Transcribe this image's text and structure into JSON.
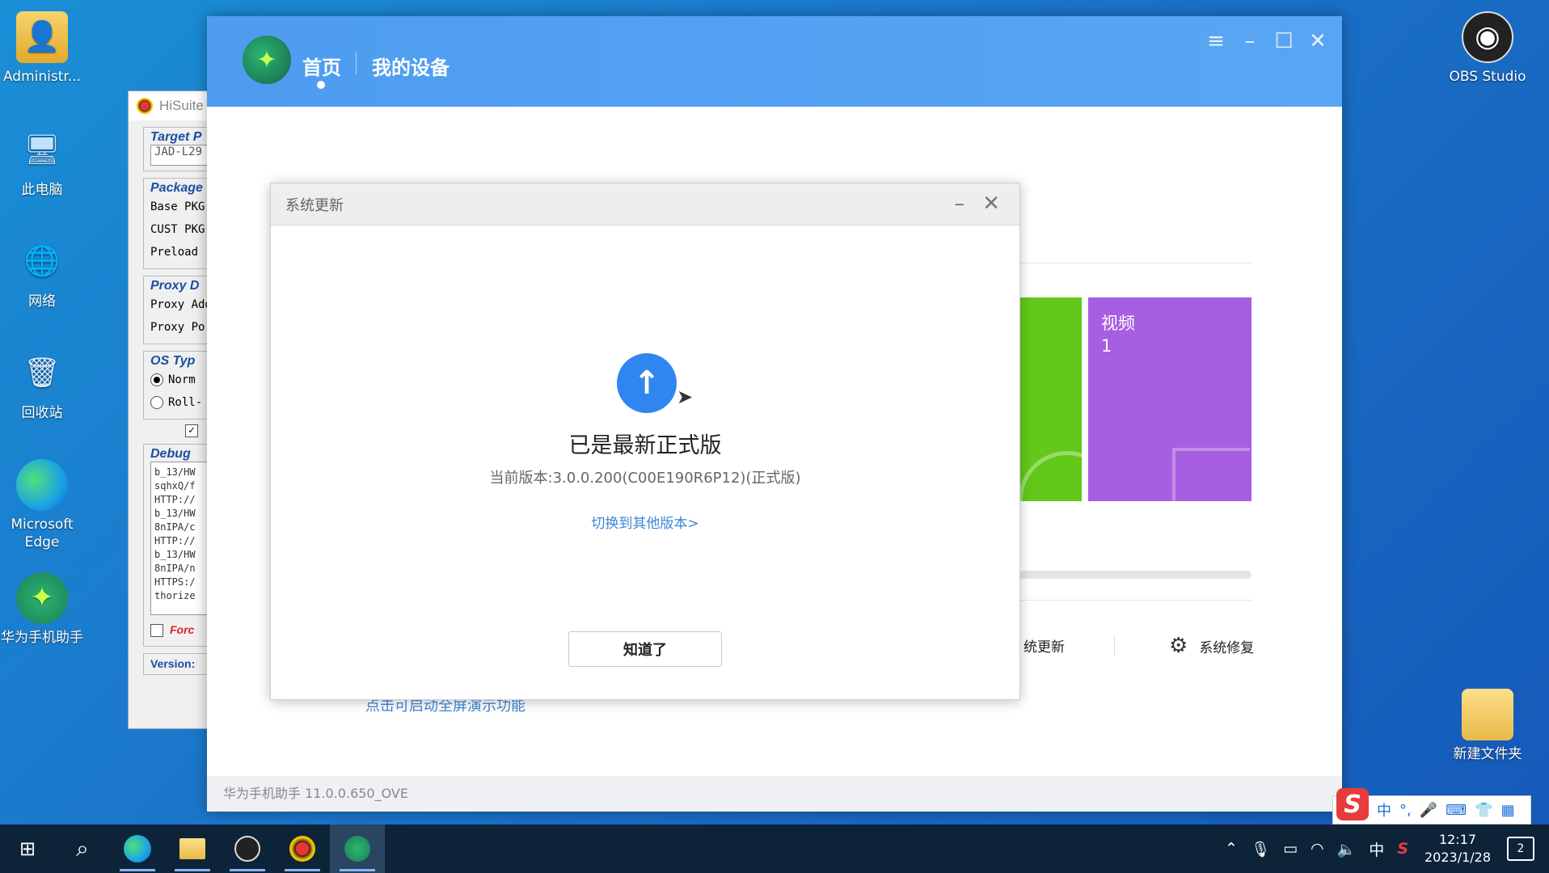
{
  "desktop": {
    "icons": [
      {
        "label": "Administr..."
      },
      {
        "label": "此电脑"
      },
      {
        "label": "网络"
      },
      {
        "label": "回收站"
      },
      {
        "label": "Microsoft Edge"
      },
      {
        "label": "华为手机助手"
      },
      {
        "label": "OBS Studio"
      },
      {
        "label": "新建文件夹"
      }
    ]
  },
  "hisuite": {
    "title": "HiSuite",
    "target_legend": "Target P",
    "target_value": "JAD-L29",
    "package_legend": "Package",
    "base_pkg": "Base PKG",
    "cust_pkg": "CUST PKG",
    "preload": "Preload",
    "proxy_legend": "Proxy D",
    "proxy_addr": "Proxy Add",
    "proxy_port": "Proxy Po",
    "os_legend": "OS Typ",
    "os_normal": "Norm",
    "os_roll": "Roll-",
    "debug_legend": "Debug",
    "debug_lines": [
      "b_13/HW",
      "sqhxQ/f",
      "HTTP://",
      "b_13/HW",
      "8nIPA/c",
      "HTTP://",
      "b_13/HW",
      "8nIPA/n",
      "HTTPS:/",
      "thorize"
    ],
    "force_label": "Forc",
    "version_label": "Version:"
  },
  "main": {
    "nav_home": "首页",
    "nav_device": "我的设备",
    "tile_video_label": "视频",
    "tile_video_count": "1",
    "system_update_partial": "统更新",
    "system_repair": "系统修复",
    "demo_link": "点击可启动全屏演示功能",
    "footer": "华为手机助手 11.0.0.650_OVE"
  },
  "dialog": {
    "title": "系统更新",
    "heading": "已是最新正式版",
    "current_version": "当前版本:3.0.0.200(C00E190R6P12)(正式版)",
    "switch_link": "切换到其他版本>",
    "ok_button": "知道了"
  },
  "ime": {
    "chars": [
      "中",
      "°,",
      "🎤",
      "⌨",
      "👕",
      "▦"
    ]
  },
  "taskbar": {
    "tray_lang": "中",
    "time": "12:17",
    "date": "2023/1/28",
    "notification_count": "2"
  },
  "colors": {
    "header_blue": "#4d9cf0",
    "accent_blue": "#2f86f0",
    "link_blue": "#3b86d8",
    "tile_green": "#62c91a",
    "tile_purple": "#a75ee0",
    "desktop_blue": "#1a8fd6"
  }
}
